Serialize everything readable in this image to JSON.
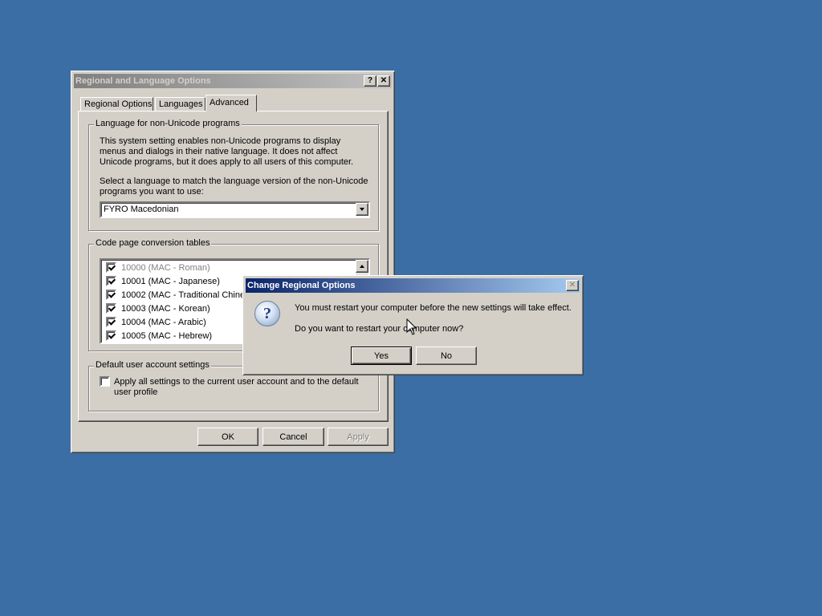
{
  "main_dialog": {
    "title": "Regional and Language Options",
    "help_button": "?",
    "close_button": "✕",
    "tabs": [
      {
        "label": "Regional Options",
        "selected": false
      },
      {
        "label": "Languages",
        "selected": false
      },
      {
        "label": "Advanced",
        "selected": true
      }
    ],
    "non_unicode_group": {
      "label": "Language for non-Unicode programs",
      "description": "This system setting enables non-Unicode programs to display menus and dialogs in their native language. It does not affect Unicode programs, but it does apply to all users of this computer.",
      "select_prompt": "Select a language to match the language version of the non-Unicode programs you want to use:",
      "selected_language": "FYRO Macedonian"
    },
    "code_page_group": {
      "label": "Code page conversion tables",
      "items": [
        {
          "label": "10000 (MAC - Roman)",
          "checked": true,
          "disabled": true
        },
        {
          "label": "10001 (MAC - Japanese)",
          "checked": true,
          "disabled": false
        },
        {
          "label": "10002 (MAC - Traditional Chinese Big5)",
          "checked": true,
          "disabled": false
        },
        {
          "label": "10003 (MAC - Korean)",
          "checked": true,
          "disabled": false
        },
        {
          "label": "10004 (MAC - Arabic)",
          "checked": true,
          "disabled": false
        },
        {
          "label": "10005 (MAC - Hebrew)",
          "checked": true,
          "disabled": false
        }
      ]
    },
    "default_user_group": {
      "label": "Default user account settings",
      "checkbox_label": "Apply all settings to the current user account and to the default user profile",
      "checked": false
    },
    "buttons": {
      "ok": "OK",
      "cancel": "Cancel",
      "apply": "Apply"
    }
  },
  "confirm_dialog": {
    "title": "Change Regional Options",
    "close_button": "✕",
    "icon": "question-icon",
    "message_line1": "You must restart your computer before the new settings will take effect.",
    "message_line2": "Do you want to restart your computer now?",
    "buttons": {
      "yes": "Yes",
      "no": "No"
    }
  },
  "colors": {
    "desktop": "#3a6ea5",
    "active_title": "#0a246a",
    "inactive_title": "#808080",
    "face": "#d4d0c8"
  }
}
